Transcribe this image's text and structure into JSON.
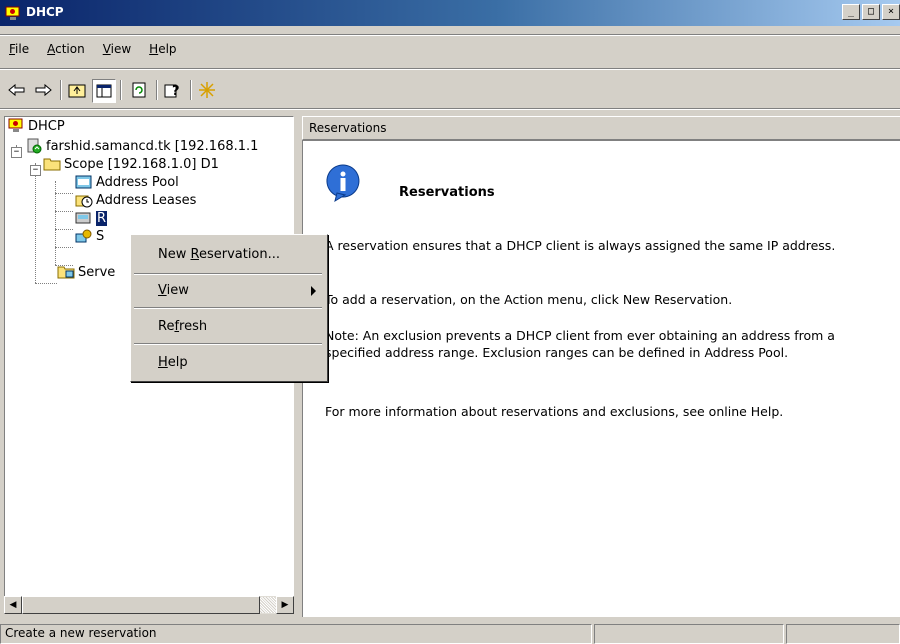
{
  "window": {
    "title": "DHCP",
    "min": "_",
    "max": "□",
    "close": "×"
  },
  "menu": [
    {
      "label": "File",
      "mnemonic": "F",
      "rest": "ile"
    },
    {
      "label": "Action",
      "mnemonic": "A",
      "rest": "ction"
    },
    {
      "label": "View",
      "mnemonic": "V",
      "rest": "iew"
    },
    {
      "label": "Help",
      "mnemonic": "H",
      "rest": "elp"
    }
  ],
  "toolbar": {
    "buttons": [
      "back-icon",
      "forward-icon",
      "up-icon",
      "show-hide-tree-icon",
      "refresh-icon",
      "help-icon",
      "new-star-icon"
    ]
  },
  "tree": {
    "root": "DHCP",
    "server": "farshid.samancd.tk [192.168.1.1",
    "scope": "Scope [192.168.1.0] D1",
    "address_pool": "Address Pool",
    "address_leases": "Address Leases",
    "reservations": "R",
    "scope_options": "S",
    "server_options": "Serve"
  },
  "right": {
    "header": "Reservations",
    "title": "Reservations",
    "p1": "A reservation ensures that a DHCP client is always assigned the same IP address.",
    "p2": "To add a reservation, on the Action menu, click New Reservation.",
    "p3": "Note: An exclusion prevents a DHCP client from ever obtaining an address from a specified address range.  Exclusion ranges can be defined in Address Pool.",
    "p4": "For more information about reservations and exclusions, see online Help."
  },
  "context_menu": {
    "new_reservation_pre": "New ",
    "new_reservation_mn": "R",
    "new_reservation_post": "eservation...",
    "view_mn": "V",
    "view_post": "iew",
    "refresh_pre": "Re",
    "refresh_mn": "f",
    "refresh_post": "resh",
    "help_mn": "H",
    "help_post": "elp"
  },
  "status": {
    "text": "Create a new reservation"
  }
}
